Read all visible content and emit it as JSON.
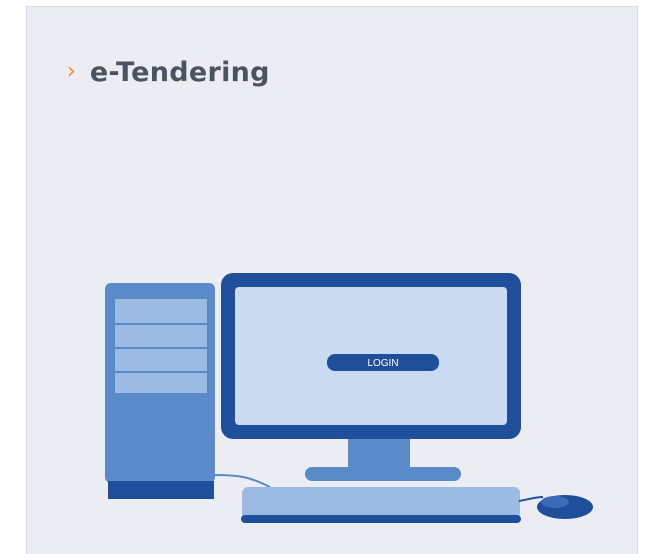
{
  "card": {
    "title": "e-Tendering",
    "chevron_icon": "chevron-right-icon",
    "accent_color": "#f08a3c",
    "title_color": "#4a5461",
    "background_color": "#ecedf3"
  },
  "illustration": {
    "screen_button_label": "LOGIN",
    "icon": "desktop-computer-icon",
    "colors": {
      "dark_blue": "#1f4f9b",
      "mid_blue": "#5b8ac9",
      "light_blue": "#9cbbe2",
      "screen_blue": "#c9daf1"
    }
  }
}
